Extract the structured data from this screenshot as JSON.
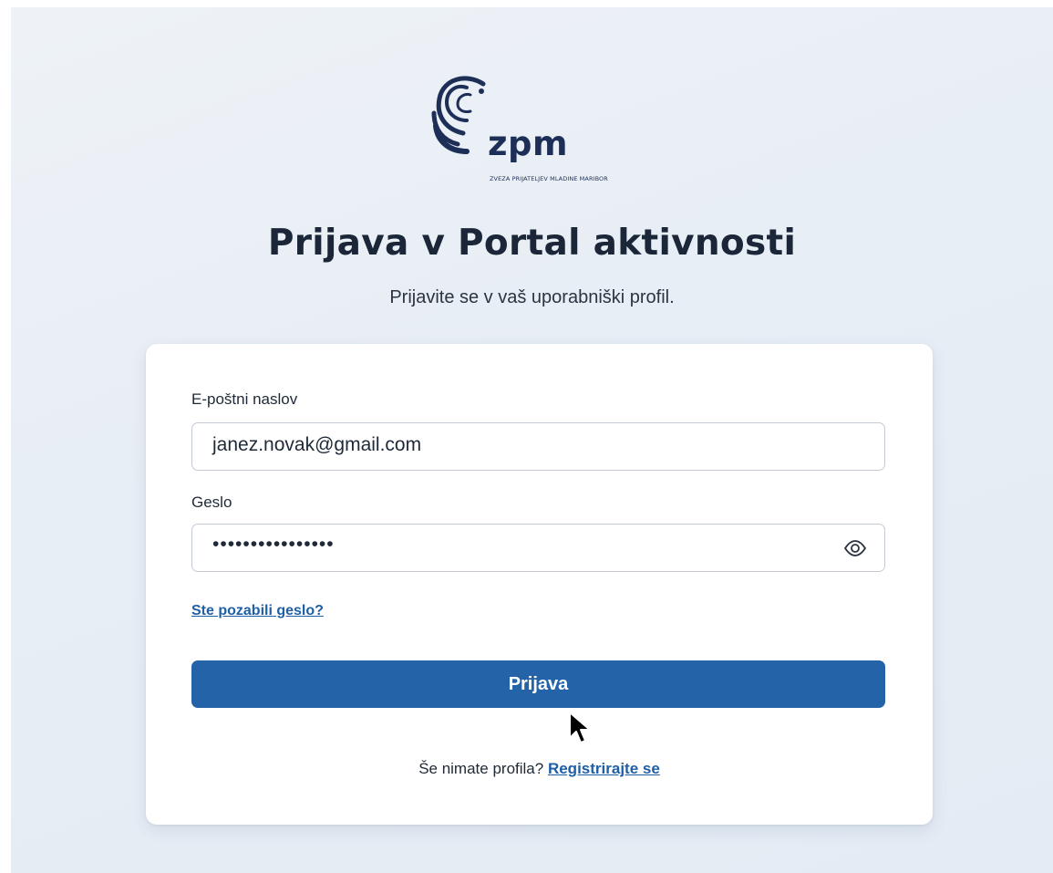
{
  "logo": {
    "wordmark": "zpm",
    "tagline": "ZVEZA PRIJATELJEV MLADINE MARIBOR"
  },
  "header": {
    "title": "Prijava v Portal aktivnosti",
    "subtitle": "Prijavite se v vaš uporabniški profil."
  },
  "form": {
    "email_label": "E-poštni naslov",
    "email_value": "janez.novak@gmail.com",
    "password_label": "Geslo",
    "password_masked": "••••••••••••••••",
    "show_password_icon": "eye-icon",
    "forgot_password": "Ste pozabili geslo?",
    "submit_label": "Prijava",
    "register_prompt": "Še nimate profila?",
    "register_link": "Registrirajte se"
  },
  "colors": {
    "primary": "#2563a8",
    "link": "#1e5fa6",
    "brand_navy": "#1d2f57",
    "background": "#e8eef5"
  }
}
